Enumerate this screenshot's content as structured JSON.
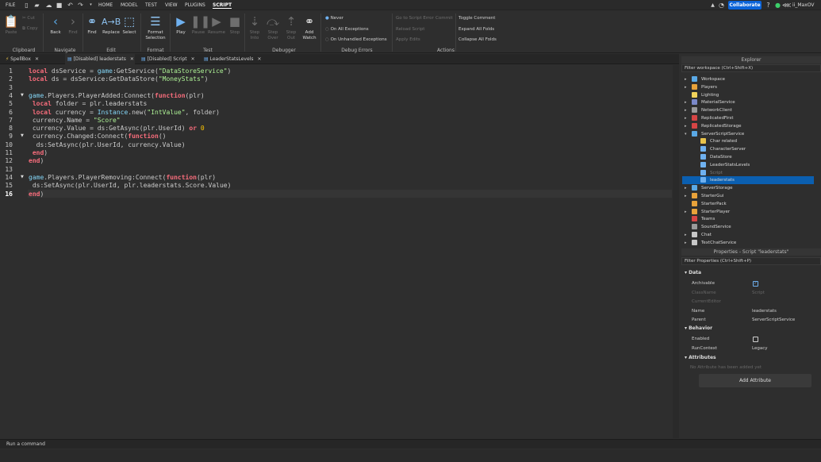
{
  "menubar": {
    "file": "FILE",
    "tabs": [
      "HOME",
      "MODEL",
      "TEST",
      "VIEW",
      "PLUGINS",
      "SCRIPT"
    ],
    "collaborate": "Collaborate",
    "username": "ii_MaxOV"
  },
  "ribbon": {
    "clipboard": {
      "paste": "Paste",
      "cut": "Cut",
      "copy": "Copy",
      "label": "Clipboard"
    },
    "navigate": {
      "back": "Back",
      "find": "Find",
      "label": "Navigate"
    },
    "edit": {
      "find": "Find",
      "replace": "Replace",
      "select": "Select",
      "label": "Edit"
    },
    "format": {
      "button": "Format",
      "button2": "Selection",
      "label": "Format"
    },
    "test": {
      "play": "Play",
      "label": "Test"
    },
    "debugger": {
      "pause": "Pause",
      "resume": "Resume",
      "stop": "Stop",
      "stepinto": "Step",
      "stepinto2": "Into",
      "stepover": "Step",
      "stepover2": "Over",
      "stepout": "Step",
      "stepout2": "Out",
      "addwatch": "Add",
      "addwatch2": "Watch",
      "label": "Debugger"
    },
    "debugerrors": {
      "never": "Never",
      "onall": "On All Exceptions",
      "onunhandled": "On Unhandled Exceptions",
      "label": "Debug Errors"
    },
    "actions": {
      "gotoerror": "Go to Script Error",
      "commit": "Commit",
      "reload": "Reload Script",
      "applyedits": "Apply Edits",
      "togglecomment": "Toggle Comment",
      "expandall": "Expand All Folds",
      "collapseall": "Collapse All Folds",
      "label": "Actions"
    }
  },
  "tabs": [
    {
      "label": "SpellBox"
    },
    {
      "label": "[Disabled] leaderstats"
    },
    {
      "label": "[Disabled] Script"
    },
    {
      "label": "LeaderStatsLevels"
    }
  ],
  "editor": {
    "lines": [
      "local dsService = game:GetService(\"DataStoreService\")",
      "local ds = dsService:GetDataStore(\"MoneyStats\")",
      "",
      "game.Players.PlayerAdded:Connect(function(plr)",
      " local folder = plr.leaderstats",
      " local currency = Instance.new(\"IntValue\", folder)",
      " currency.Name = \"Score\"",
      " currency.Value = ds:GetAsync(plr.UserId) or 0",
      " currency.Changed:Connect(function()",
      "  ds:SetAsync(plr.UserId, currency.Value)",
      " end)",
      "end)",
      "",
      "game.Players.PlayerRemoving:Connect(function(plr)",
      " ds:SetAsync(plr.UserId, plr.leaderstats.Score.Value)",
      "end)"
    ],
    "line_numbers": [
      "1",
      "2",
      "3",
      "4",
      "5",
      "6",
      "7",
      "8",
      "9",
      "10",
      "11",
      "12",
      "13",
      "14",
      "15",
      "16"
    ],
    "current_line": "16"
  },
  "explorer": {
    "title": "Explorer",
    "filter": "Filter workspace (Ctrl+Shift+X)",
    "items": [
      {
        "label": "Workspace",
        "color": "#5aa9e6"
      },
      {
        "label": "Players",
        "color": "#e8a23a"
      },
      {
        "label": "Lighting",
        "color": "#f2d35b"
      },
      {
        "label": "MaterialService",
        "color": "#7b89c9"
      },
      {
        "label": "NetworkClient",
        "color": "#9a9a9a"
      },
      {
        "label": "ReplicatedFirst",
        "color": "#d64545"
      },
      {
        "label": "ReplicatedStorage",
        "color": "#d64545"
      },
      {
        "label": "ServerScriptService",
        "color": "#5aa9e6"
      },
      {
        "label": "Char related",
        "color": "#e8c24a"
      },
      {
        "label": "CharacterServer",
        "color": "#6fb1f0"
      },
      {
        "label": "DataStore",
        "color": "#6fb1f0"
      },
      {
        "label": "LeaderStatsLevels",
        "color": "#6fb1f0"
      },
      {
        "label": "Script",
        "color": "#6fb1f0"
      },
      {
        "label": "leaderstats",
        "color": "#6fb1f0"
      },
      {
        "label": "ServerStorage",
        "color": "#5aa9e6"
      },
      {
        "label": "StarterGui",
        "color": "#e8a23a"
      },
      {
        "label": "StarterPack",
        "color": "#e8a23a"
      },
      {
        "label": "StarterPlayer",
        "color": "#e8a23a"
      },
      {
        "label": "Teams",
        "color": "#d64545"
      },
      {
        "label": "SoundService",
        "color": "#9a9a9a"
      },
      {
        "label": "Chat",
        "color": "#c8c8c8"
      },
      {
        "label": "TextChatService",
        "color": "#c8c8c8"
      }
    ]
  },
  "properties": {
    "title": "Properties - Script \"leaderstats\"",
    "filter": "Filter Properties (Ctrl+Shift+P)",
    "sections": {
      "data": "Data",
      "behavior": "Behavior",
      "attributes": "Attributes"
    },
    "rows": {
      "archivable": "Archivable",
      "classname": "ClassName",
      "classname_val": "Script",
      "currenteditor": "CurrentEditor",
      "name": "Name",
      "name_val": "leaderstats",
      "parent": "Parent",
      "parent_val": "ServerScriptService",
      "enabled": "Enabled",
      "runcontext": "RunContext",
      "runcontext_val": "Legacy"
    },
    "no_attr": "No Attribute has been added yet",
    "add_attr": "Add Attribute"
  },
  "command": {
    "placeholder": "Run a command"
  }
}
